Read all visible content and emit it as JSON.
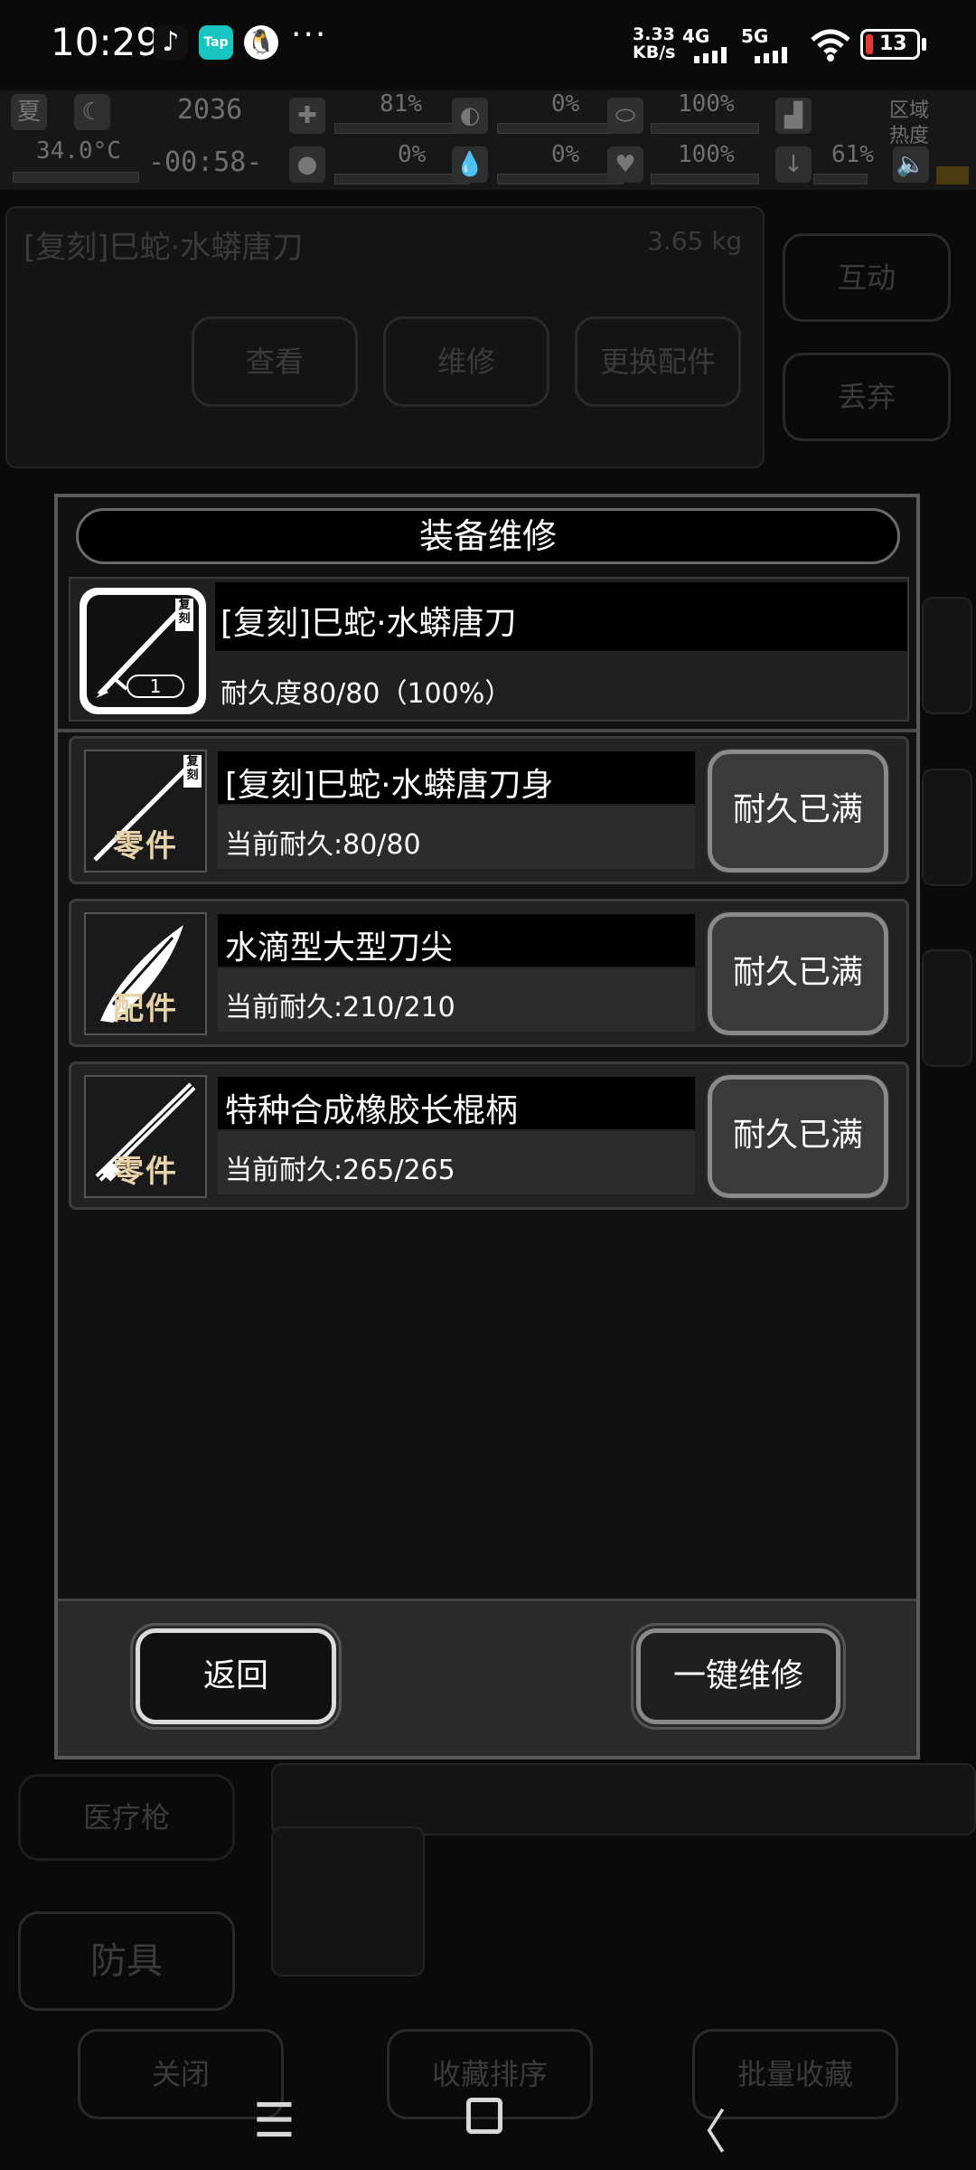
{
  "status_bar": {
    "time": "10:29",
    "tiktok_icon": "♪",
    "tap_icon": "Tap",
    "qq_icon": "QQ",
    "more": "···",
    "speed": "3.33\nKB/s",
    "network_1": "4G",
    "network_2": "5G",
    "battery": "13"
  },
  "hud": {
    "season": "夏",
    "temperature": "34.0°C",
    "clock_value": "2036",
    "timer": "-00:58-",
    "stat1": "81%",
    "stat2": "0%",
    "stat3": "100%",
    "stat4": "0%",
    "stat5": "0%",
    "stat6": "100%",
    "stat7": "61%",
    "zone_label_1": "区域",
    "zone_label_2": "热度"
  },
  "background": {
    "item_title": "[复刻]巳蛇·水蟒唐刀",
    "item_weight": "3.65 kg",
    "view_label": "查看",
    "repair_label": "维修",
    "replace_label": "更换配件",
    "interact_label": "互动",
    "discard_label": "丢弃",
    "medgun_label": "医疗枪",
    "armor_label": "防具",
    "close_label": "关闭",
    "sort_label": "收藏排序",
    "batch_label": "批量收藏"
  },
  "modal": {
    "title": "装备维修",
    "main_item": {
      "name": "[复刻]巳蛇·水蟒唐刀",
      "durability": "耐久度80/80（100%）",
      "count": "1",
      "badge": "复刻"
    },
    "parts": [
      {
        "name": "[复刻]巳蛇·水蟒唐刀身",
        "durability": "当前耐久:80/80",
        "tag": "零件",
        "button": "耐久已满",
        "badge": "复刻"
      },
      {
        "name": "水滴型大型刀尖",
        "durability": "当前耐久:210/210",
        "tag": "配件",
        "button": "耐久已满"
      },
      {
        "name": "特种合成橡胶长棍柄",
        "durability": "当前耐久:265/265",
        "tag": "零件",
        "button": "耐久已满"
      }
    ],
    "back_button": "返回",
    "repair_all_button": "一键维修"
  },
  "nav": {
    "menu_icon": "☰",
    "home_icon": "▢",
    "back_icon": "〈"
  },
  "colors": {
    "background": "#0a0a0a",
    "modal_bg": "#111111",
    "part_tag": "#e8d2a8",
    "battery_low": "#e53935"
  }
}
